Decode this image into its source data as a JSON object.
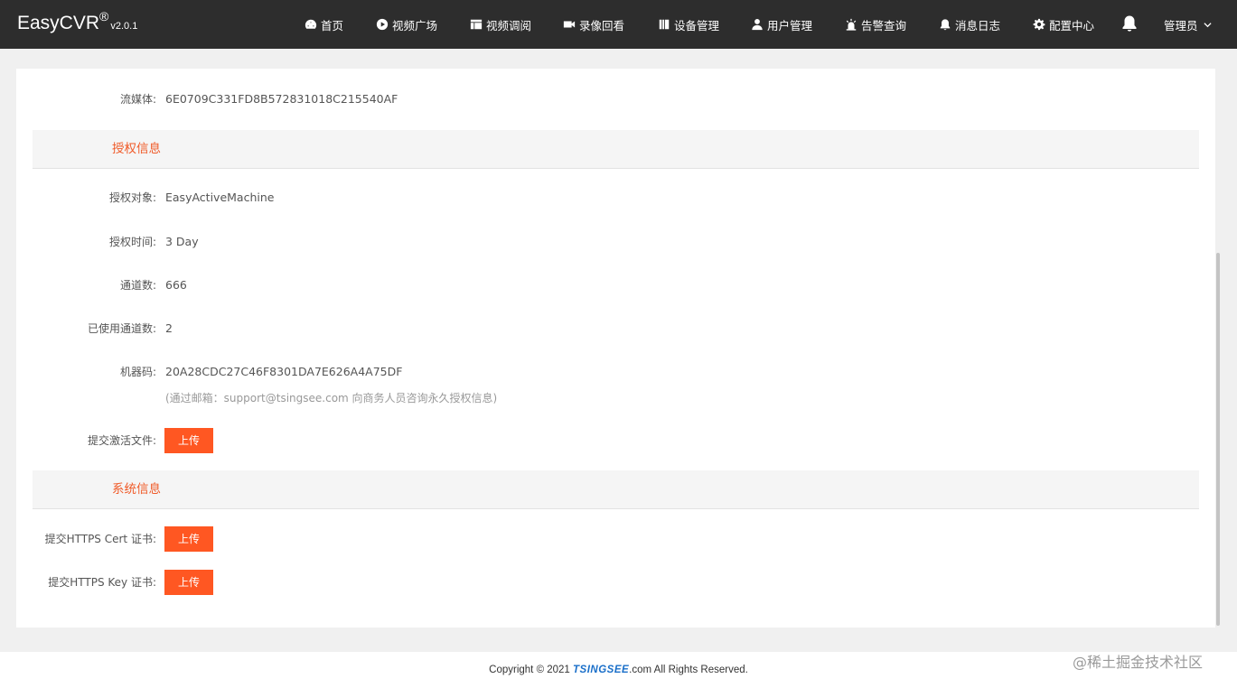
{
  "header": {
    "brand": "EasyCVR",
    "brand_mark": "®",
    "version": "v2.0.1",
    "nav": [
      {
        "label": "首页",
        "icon": "dashboard-icon"
      },
      {
        "label": "视频广场",
        "icon": "play-circle-icon"
      },
      {
        "label": "视频调阅",
        "icon": "grid-icon"
      },
      {
        "label": "录像回看",
        "icon": "video-camera-icon"
      },
      {
        "label": "设备管理",
        "icon": "device-icon"
      },
      {
        "label": "用户管理",
        "icon": "user-icon"
      },
      {
        "label": "告警查询",
        "icon": "alarm-icon"
      },
      {
        "label": "消息日志",
        "icon": "bell-small-icon"
      },
      {
        "label": "配置中心",
        "icon": "gear-icon"
      }
    ],
    "bell_icon": "bell-icon",
    "user": "管理员"
  },
  "streaming": {
    "label": "流媒体:",
    "value": "6E0709C331FD8B572831018C215540AF"
  },
  "license_section": {
    "title": "授权信息",
    "target_label": "授权对象:",
    "target_value": "EasyActiveMachine",
    "time_label": "授权时间:",
    "time_value": "3 Day",
    "channels_label": "通道数:",
    "channels_value": "666",
    "used_label": "已使用通道数:",
    "used_value": "2",
    "machine_label": "机器码:",
    "machine_value": "20A28CDC27C46F8301DA7E626A4A75DF",
    "machine_hint": "(通过邮箱：support@tsingsee.com 向商务人员咨询永久授权信息)",
    "activation_label": "提交激活文件:",
    "upload_label": "上传"
  },
  "system_section": {
    "title": "系统信息",
    "cert_label": "提交HTTPS Cert 证书:",
    "key_label": "提交HTTPS Key 证书:",
    "upload_label": "上传"
  },
  "footer": {
    "copyright_pre": "Copyright © 2021 ",
    "brand": "TSINGSEE",
    "copyright_post": ".com All Rights Reserved."
  },
  "watermark": "@稀土掘金技术社区",
  "colors": {
    "header_bg": "#2d2d2d",
    "accent": "#ff5722",
    "section_title": "#f05a28"
  }
}
